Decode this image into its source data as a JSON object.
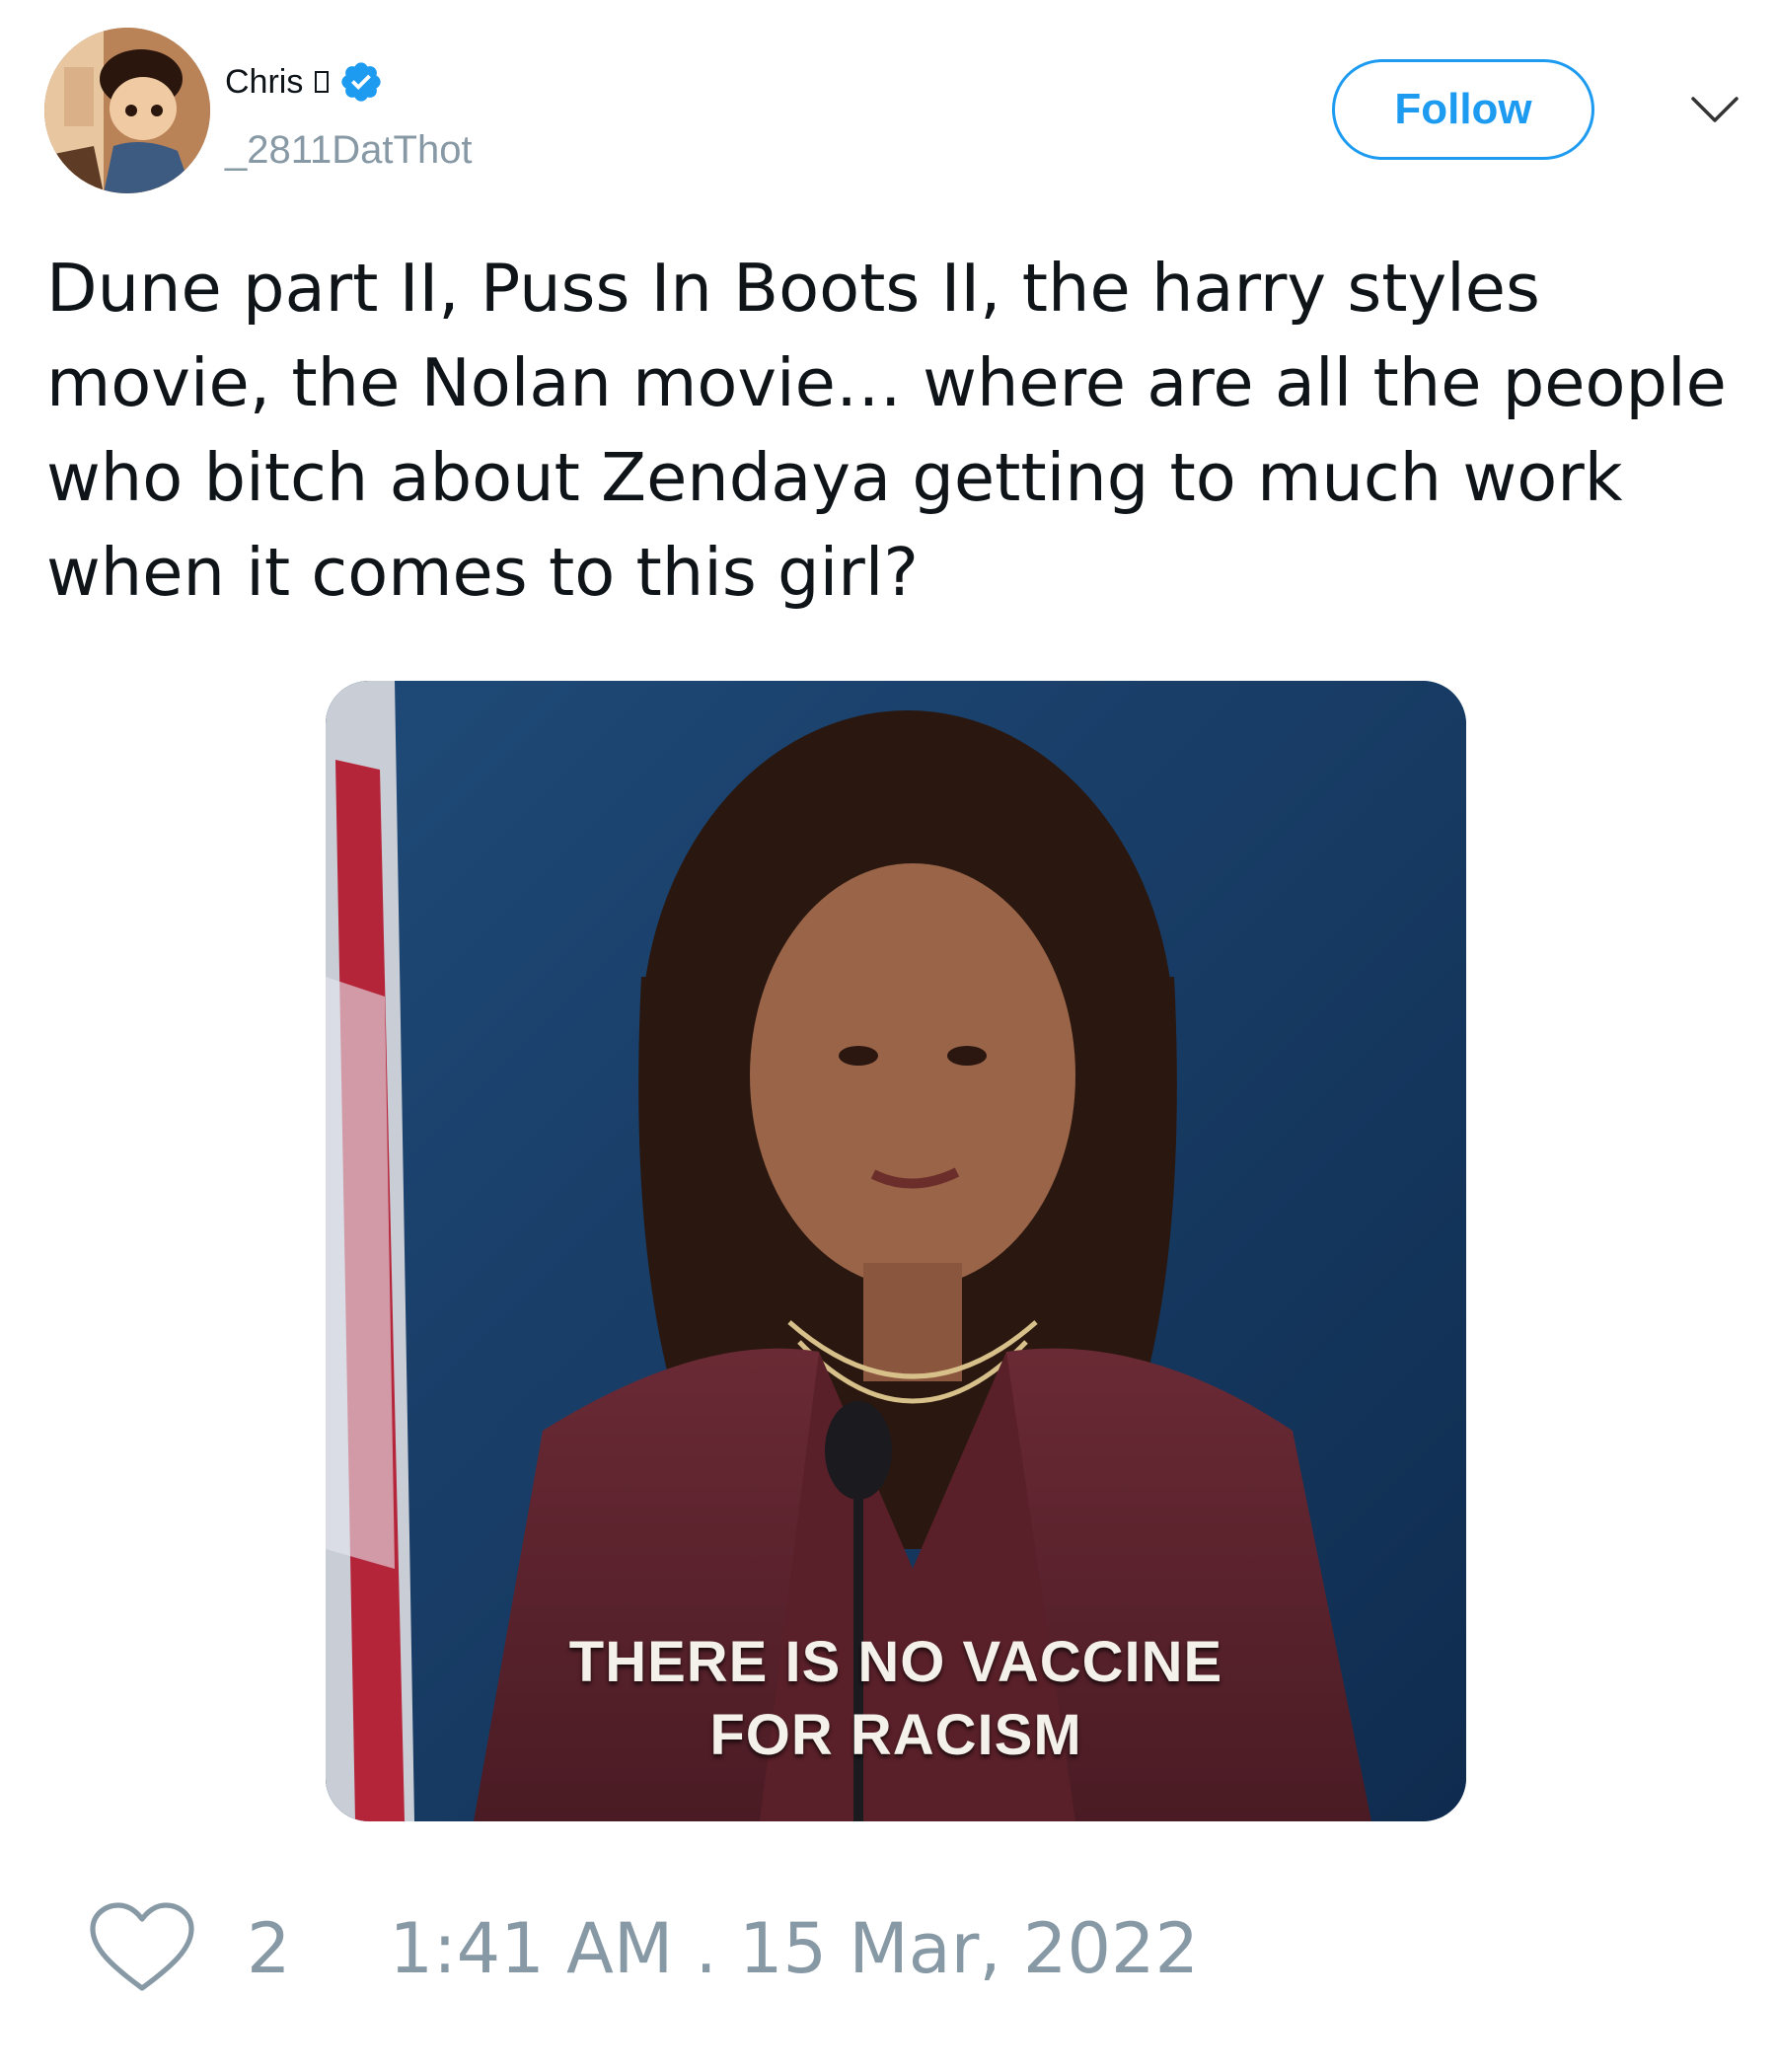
{
  "author": {
    "display_name": "Chris",
    "handle": "_2811DatThot",
    "verified": true,
    "avatar_icon": "cartoon-avatar"
  },
  "actions": {
    "follow_label": "Follow",
    "menu_icon": "chevron-down-icon"
  },
  "tweet": {
    "text": "Dune part II, Puss In Boots II, the harry styles movie, the Nolan movie… where are all the people who bitch about Zendaya getting to much work when it comes to this girl?",
    "media": {
      "caption_line1": "THERE IS NO VACCINE",
      "caption_line2": "FOR RACISM"
    }
  },
  "footer": {
    "like_icon": "heart-outline-icon",
    "like_count": "2",
    "timestamp": "1:41 AM . 15 Mar, 2022"
  },
  "colors": {
    "accent": "#1d9bf0",
    "muted": "#8899a6",
    "text": "#0f1419"
  }
}
